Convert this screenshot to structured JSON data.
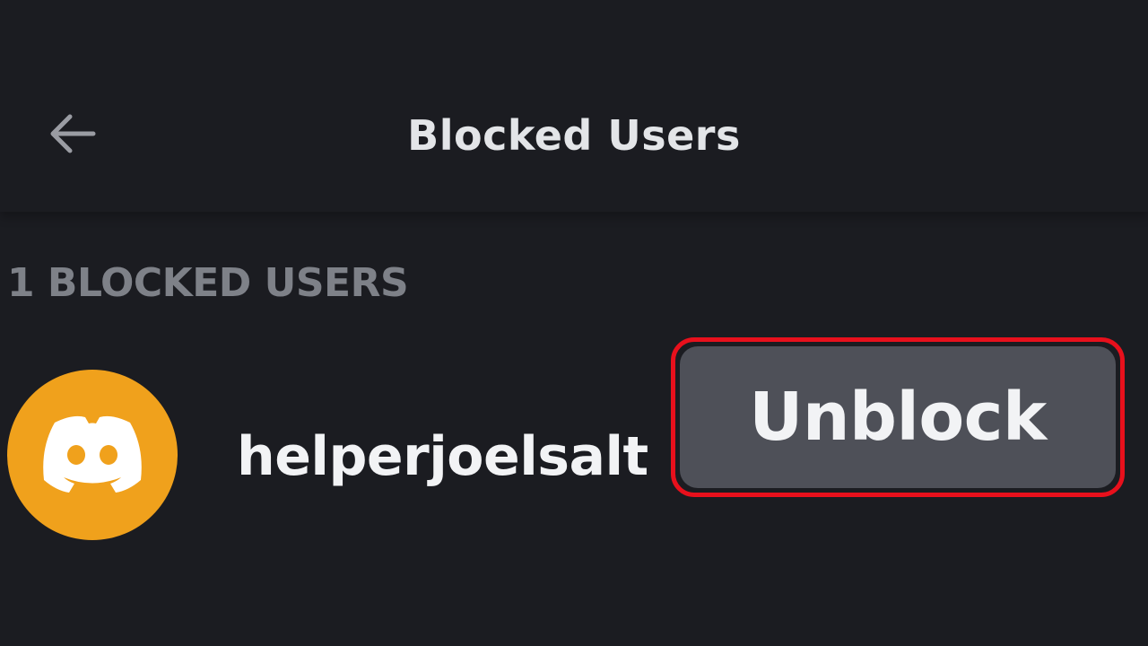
{
  "header": {
    "title": "Blocked Users",
    "back_icon": "arrow-left-icon"
  },
  "blocked_list": {
    "heading": "1 BLOCKED USERS",
    "users": [
      {
        "username": "helperjoelsalt",
        "avatar_icon": "discord-logo-icon",
        "avatar_color": "#f0a11c",
        "action_label": "Unblock"
      }
    ]
  },
  "colors": {
    "background": "#1b1c21",
    "button_bg": "#4e5058",
    "highlight": "#e8101c",
    "muted_text": "#7e8188"
  }
}
